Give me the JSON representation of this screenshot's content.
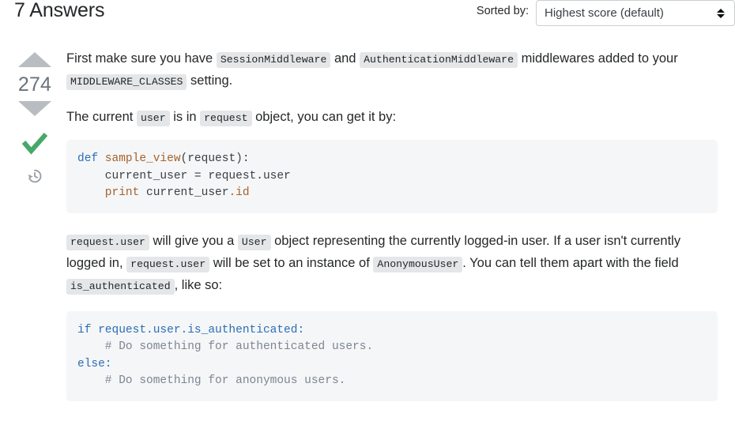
{
  "header": {
    "answers_count_label": "7 Answers",
    "sorted_by_label": "Sorted by:",
    "sort_selected_value": "Highest score (default)"
  },
  "answer": {
    "vote_score": "274",
    "accepted_icon": "checkmark-icon",
    "history_icon": "clock-history-icon",
    "upvote_icon": "triangle-up-icon",
    "downvote_icon": "triangle-down-icon",
    "paragraph1": {
      "t1": "First make sure you have ",
      "c1": "SessionMiddleware",
      "t2": " and ",
      "c2": "AuthenticationMiddleware",
      "t3": " middlewares added to your ",
      "c3": "MIDDLEWARE_CLASSES",
      "t4": " setting."
    },
    "paragraph2": {
      "t1": "The current ",
      "c1": "user",
      "t2": " is in ",
      "c2": "request",
      "t3": " object, you can get it by:"
    },
    "code1": {
      "l1_k": "def",
      "l1_fn": " sample_view",
      "l1_pl": "(request):",
      "l2_pl": "    current_user = request.user",
      "l3_fn": "    print",
      "l3_pl": " current_user",
      "l3_attr": ".id"
    },
    "paragraph3": {
      "c1": "request.user",
      "t1": " will give you a ",
      "c2": "User",
      "t2": " object representing the currently logged-in user. If a user isn't currently logged in, ",
      "c3": "request.user",
      "t3": " will be set to an instance of ",
      "c4": "AnonymousUser",
      "t4": ". You can tell them apart with the field ",
      "c5": "is_authenticated",
      "t5": ", like so:"
    },
    "code2": {
      "l1": "if request.user.is_authenticated:",
      "l2": "    # Do something for authenticated users.",
      "l3": "else:",
      "l4": "    # Do something for anonymous users."
    }
  },
  "colors": {
    "accepted_green": "#48a868",
    "vote_arrow_gray": "#b9bcc0",
    "vote_count_gray": "#6a737c",
    "code_bg": "#f5f6f7",
    "inline_code_bg": "#e4e6e8",
    "keyword_blue": "#2b6eb5",
    "function_orange": "#a6622c",
    "comment_gray": "#7c8693",
    "select_border": "#cbcfd3"
  }
}
